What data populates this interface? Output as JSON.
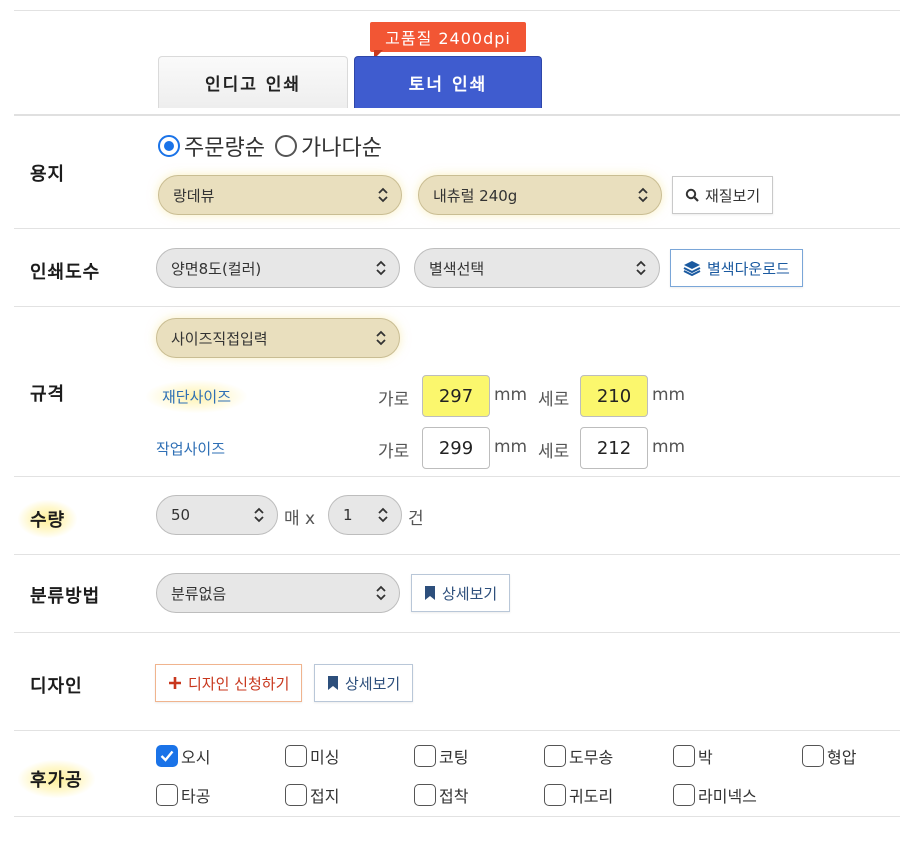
{
  "tabs": {
    "badge": "고품질 2400dpi",
    "indigo": "인디고 인쇄",
    "toner": "토너 인쇄"
  },
  "paper": {
    "label": "용지",
    "sort_options": [
      "주문량순",
      "가나다순"
    ],
    "sort_selected": "주문량순",
    "type_value": "랑데뷰",
    "weight_value": "내츄럴 240g",
    "view_button": "재질보기"
  },
  "print_color": {
    "label": "인쇄도수",
    "color_value": "양면8도(컬러)",
    "spot_value": "별색선택",
    "download_button": "별색다운로드"
  },
  "size": {
    "label": "규격",
    "size_value": "사이즈직접입력",
    "cut_label": "재단사이즈",
    "work_label": "작업사이즈",
    "width_label": "가로",
    "height_label": "세로",
    "unit": "mm",
    "cut_width": "297",
    "cut_height": "210",
    "work_width": "299",
    "work_height": "212"
  },
  "quantity": {
    "label": "수량",
    "count_value": "50",
    "count_unit": "매 x",
    "sets_value": "1",
    "sets_unit": "건"
  },
  "sorting": {
    "label": "분류방법",
    "value": "분류없음",
    "detail_button": "상세보기"
  },
  "design": {
    "label": "디자인",
    "apply_button": "디자인 신청하기",
    "detail_button": "상세보기"
  },
  "post_processing": {
    "label": "후가공",
    "options": [
      {
        "label": "오시",
        "checked": true
      },
      {
        "label": "미싱",
        "checked": false
      },
      {
        "label": "코팅",
        "checked": false
      },
      {
        "label": "도무송",
        "checked": false
      },
      {
        "label": "박",
        "checked": false
      },
      {
        "label": "형압",
        "checked": false
      },
      {
        "label": "타공",
        "checked": false
      },
      {
        "label": "접지",
        "checked": false
      },
      {
        "label": "접착",
        "checked": false
      },
      {
        "label": "귀도리",
        "checked": false
      },
      {
        "label": "라미넥스",
        "checked": false
      }
    ]
  },
  "colors": {
    "accent_blue": "#3f5ccf",
    "badge_red": "#f25634",
    "highlight_yellow": "#fbf76d",
    "link_blue": "#2e6fb5"
  }
}
